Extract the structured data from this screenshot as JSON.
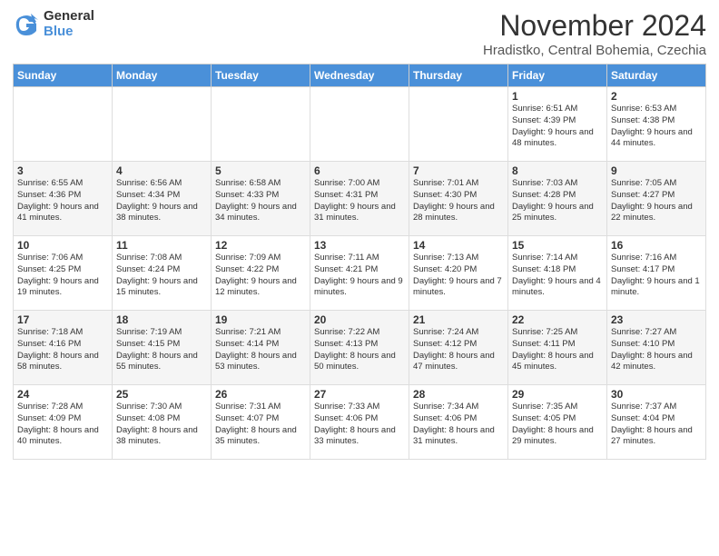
{
  "logo": {
    "general": "General",
    "blue": "Blue"
  },
  "header": {
    "month": "November 2024",
    "location": "Hradistko, Central Bohemia, Czechia"
  },
  "weekdays": [
    "Sunday",
    "Monday",
    "Tuesday",
    "Wednesday",
    "Thursday",
    "Friday",
    "Saturday"
  ],
  "weeks": [
    [
      {
        "day": "",
        "info": ""
      },
      {
        "day": "",
        "info": ""
      },
      {
        "day": "",
        "info": ""
      },
      {
        "day": "",
        "info": ""
      },
      {
        "day": "",
        "info": ""
      },
      {
        "day": "1",
        "info": "Sunrise: 6:51 AM\nSunset: 4:39 PM\nDaylight: 9 hours and 48 minutes."
      },
      {
        "day": "2",
        "info": "Sunrise: 6:53 AM\nSunset: 4:38 PM\nDaylight: 9 hours and 44 minutes."
      }
    ],
    [
      {
        "day": "3",
        "info": "Sunrise: 6:55 AM\nSunset: 4:36 PM\nDaylight: 9 hours and 41 minutes."
      },
      {
        "day": "4",
        "info": "Sunrise: 6:56 AM\nSunset: 4:34 PM\nDaylight: 9 hours and 38 minutes."
      },
      {
        "day": "5",
        "info": "Sunrise: 6:58 AM\nSunset: 4:33 PM\nDaylight: 9 hours and 34 minutes."
      },
      {
        "day": "6",
        "info": "Sunrise: 7:00 AM\nSunset: 4:31 PM\nDaylight: 9 hours and 31 minutes."
      },
      {
        "day": "7",
        "info": "Sunrise: 7:01 AM\nSunset: 4:30 PM\nDaylight: 9 hours and 28 minutes."
      },
      {
        "day": "8",
        "info": "Sunrise: 7:03 AM\nSunset: 4:28 PM\nDaylight: 9 hours and 25 minutes."
      },
      {
        "day": "9",
        "info": "Sunrise: 7:05 AM\nSunset: 4:27 PM\nDaylight: 9 hours and 22 minutes."
      }
    ],
    [
      {
        "day": "10",
        "info": "Sunrise: 7:06 AM\nSunset: 4:25 PM\nDaylight: 9 hours and 19 minutes."
      },
      {
        "day": "11",
        "info": "Sunrise: 7:08 AM\nSunset: 4:24 PM\nDaylight: 9 hours and 15 minutes."
      },
      {
        "day": "12",
        "info": "Sunrise: 7:09 AM\nSunset: 4:22 PM\nDaylight: 9 hours and 12 minutes."
      },
      {
        "day": "13",
        "info": "Sunrise: 7:11 AM\nSunset: 4:21 PM\nDaylight: 9 hours and 9 minutes."
      },
      {
        "day": "14",
        "info": "Sunrise: 7:13 AM\nSunset: 4:20 PM\nDaylight: 9 hours and 7 minutes."
      },
      {
        "day": "15",
        "info": "Sunrise: 7:14 AM\nSunset: 4:18 PM\nDaylight: 9 hours and 4 minutes."
      },
      {
        "day": "16",
        "info": "Sunrise: 7:16 AM\nSunset: 4:17 PM\nDaylight: 9 hours and 1 minute."
      }
    ],
    [
      {
        "day": "17",
        "info": "Sunrise: 7:18 AM\nSunset: 4:16 PM\nDaylight: 8 hours and 58 minutes."
      },
      {
        "day": "18",
        "info": "Sunrise: 7:19 AM\nSunset: 4:15 PM\nDaylight: 8 hours and 55 minutes."
      },
      {
        "day": "19",
        "info": "Sunrise: 7:21 AM\nSunset: 4:14 PM\nDaylight: 8 hours and 53 minutes."
      },
      {
        "day": "20",
        "info": "Sunrise: 7:22 AM\nSunset: 4:13 PM\nDaylight: 8 hours and 50 minutes."
      },
      {
        "day": "21",
        "info": "Sunrise: 7:24 AM\nSunset: 4:12 PM\nDaylight: 8 hours and 47 minutes."
      },
      {
        "day": "22",
        "info": "Sunrise: 7:25 AM\nSunset: 4:11 PM\nDaylight: 8 hours and 45 minutes."
      },
      {
        "day": "23",
        "info": "Sunrise: 7:27 AM\nSunset: 4:10 PM\nDaylight: 8 hours and 42 minutes."
      }
    ],
    [
      {
        "day": "24",
        "info": "Sunrise: 7:28 AM\nSunset: 4:09 PM\nDaylight: 8 hours and 40 minutes."
      },
      {
        "day": "25",
        "info": "Sunrise: 7:30 AM\nSunset: 4:08 PM\nDaylight: 8 hours and 38 minutes."
      },
      {
        "day": "26",
        "info": "Sunrise: 7:31 AM\nSunset: 4:07 PM\nDaylight: 8 hours and 35 minutes."
      },
      {
        "day": "27",
        "info": "Sunrise: 7:33 AM\nSunset: 4:06 PM\nDaylight: 8 hours and 33 minutes."
      },
      {
        "day": "28",
        "info": "Sunrise: 7:34 AM\nSunset: 4:06 PM\nDaylight: 8 hours and 31 minutes."
      },
      {
        "day": "29",
        "info": "Sunrise: 7:35 AM\nSunset: 4:05 PM\nDaylight: 8 hours and 29 minutes."
      },
      {
        "day": "30",
        "info": "Sunrise: 7:37 AM\nSunset: 4:04 PM\nDaylight: 8 hours and 27 minutes."
      }
    ]
  ]
}
